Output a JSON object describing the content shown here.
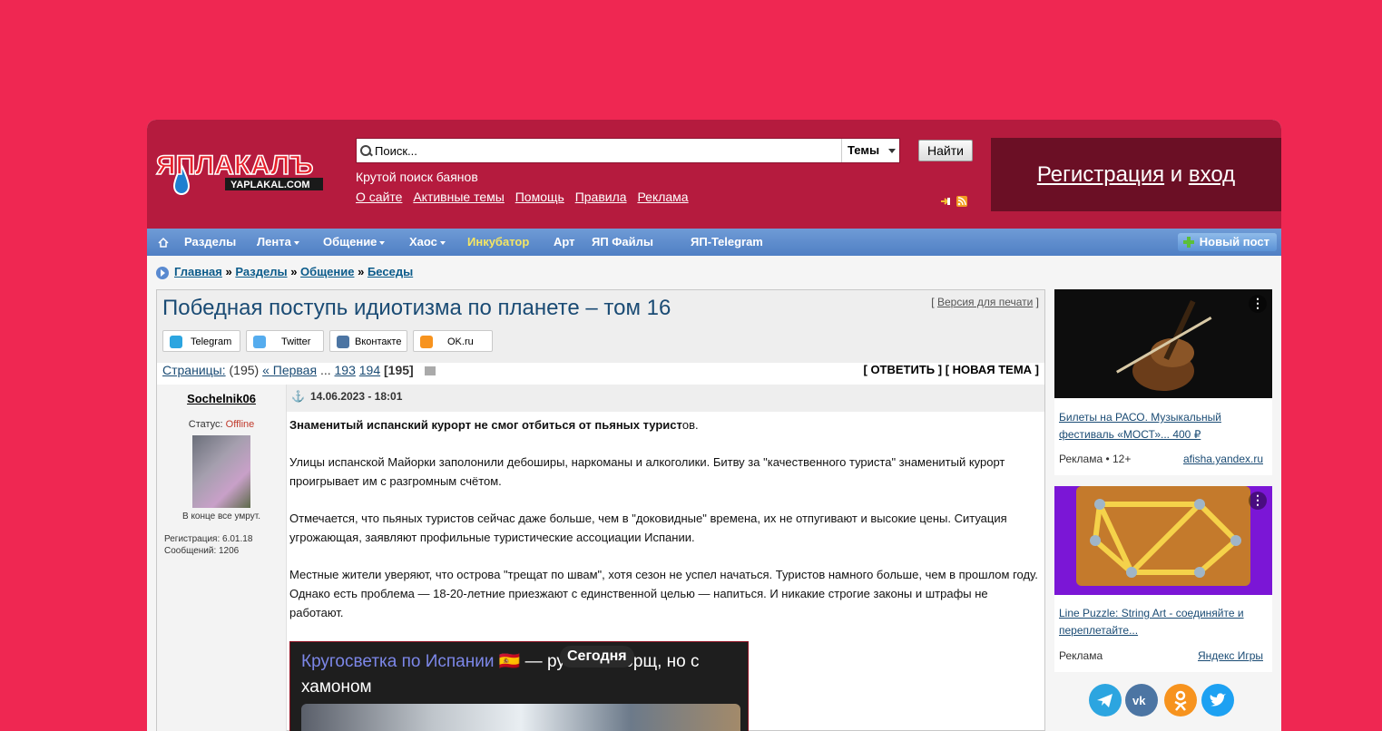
{
  "header": {
    "logo_text": "ЯПЛАКАЛЪ",
    "logo_sub": "YAPLAKAL.COM",
    "search_placeholder": "Поиск...",
    "search_scope": "Темы",
    "search_button": "Найти",
    "tagline": "Крутой поиск баянов",
    "links": [
      "О сайте",
      "Активные темы",
      "Помощь",
      "Правила",
      "Реклама"
    ],
    "register": "Регистрация",
    "and": "и",
    "login": "вход"
  },
  "nav": {
    "home_icon": "home-icon",
    "items": [
      "Разделы",
      "Лента",
      "Общение",
      "Хаос",
      "Инкубатор",
      "Арт",
      "ЯП Файлы",
      "ЯП-Telegram"
    ],
    "new_post": "Новый пост",
    "incubator_color": "#f5e663"
  },
  "breadcrumb": {
    "items": [
      "Главная",
      "Разделы",
      "Общение",
      "Беседы"
    ],
    "separator": "»"
  },
  "topic": {
    "title": "Победная поступь идиотизма по планете – том 16",
    "print_label": "Версия для печати",
    "share": [
      "Telegram",
      "Twitter",
      "Вконтакте",
      "OK.ru"
    ],
    "pages_label": "Страницы:",
    "pages_count": "(195)",
    "first": "« Первая",
    "ellipsis": "...",
    "page_a": "193",
    "page_b": "194",
    "page_current": "[195]",
    "reply": "[ ОТВЕТИТЬ ]",
    "new_topic": "[ НОВАЯ ТЕМА ]"
  },
  "post": {
    "author": "Sochelnik06",
    "status_label": "Статус:",
    "status_value": "Offline",
    "motto": "В конце все умрут.",
    "registration": "Регистрация: 6.01.18",
    "messages": "Сообщений: 1206",
    "date": "14.06.2023 - 18:01",
    "headline_bold": "Знаменитый испанский курорт не смог отбиться от пьяных турист",
    "headline_tail": "ов.",
    "paragraphs": [
      "Улицы испанской Майорки заполонили дебоширы, наркоманы и алкоголики. Битву за \"качественного туриста\" знаменитый курорт проигрывает им с разгромным счётом.",
      "Отмечается, что пьяных туристов сейчас даже больше, чем в \"доковидные\" времена, их не отпугивают и высокие цены. Ситуация угрожающая, заявляют профильные туристические ассоциации Испании.",
      "Местные жители уверяют, что острова \"трещат по швам\", хотя сезон не успел начаться. Туристов намного больше, чем в прошлом году. Однако есть проблема — 18-20-летние приезжают с единственной целью — напиться. И никакие строгие законы и штрафы не работают."
    ],
    "video_title_link": "Кругосветка по Испании 🇪🇸",
    "video_title_rest": " — русский борщ, но с хамоном",
    "video_badge": "Сегодня"
  },
  "sidebar": {
    "ads": [
      {
        "text": "Билеты на РАСО. Музыкальный фестиваль «МОСТ»... 400 ₽",
        "label": "Реклама • 12+",
        "source": "afisha.yandex.ru"
      },
      {
        "text": "Line Puzzle: String Art - соединяйте и переплетайте...",
        "label": "Реклама",
        "source": "Яндекс Игры"
      }
    ],
    "social": [
      "telegram-icon",
      "vk-icon",
      "ok-icon",
      "twitter-icon"
    ]
  }
}
